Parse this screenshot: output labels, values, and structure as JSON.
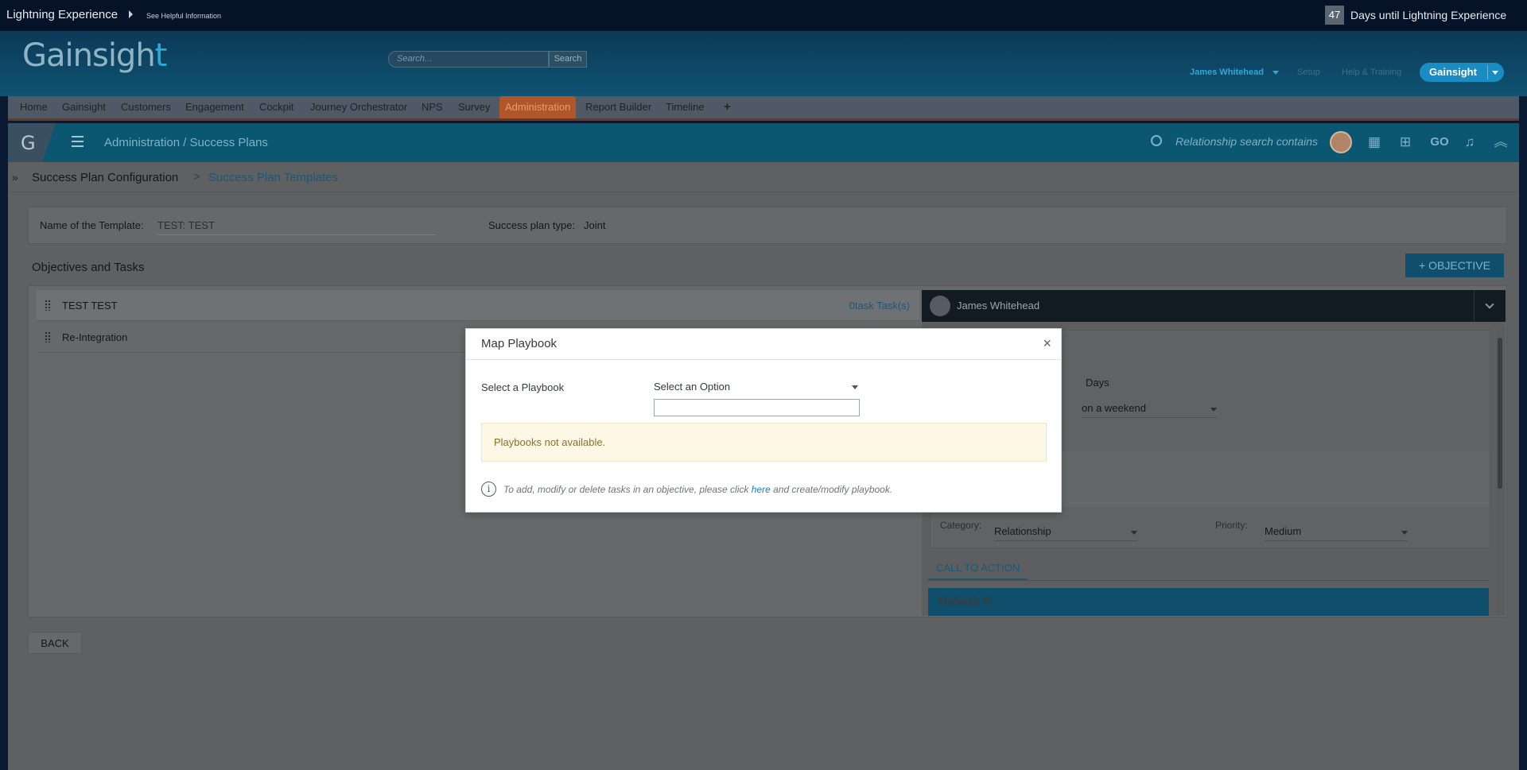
{
  "lightning": {
    "title": "Lightning Experience",
    "help": "See Helpful Information",
    "days_count": "47",
    "days_text": "Days until Lightning Experience"
  },
  "header": {
    "logo": "Gainsigh",
    "logo_t": "t",
    "search_placeholder": "Search...",
    "search_button": "Search",
    "user": "James Whitehead",
    "setup": "Setup",
    "help_training": "Help & Training",
    "app": "Gainsight"
  },
  "tabs": [
    "Home",
    "Gainsight",
    "Customers",
    "Engagement",
    "Cockpit",
    "Journey Orchestrator",
    "NPS",
    "Survey",
    "Administration",
    "Report Builder",
    "Timeline"
  ],
  "tab_plus": "+",
  "gnav": {
    "logo": "G",
    "title": "Administration / Success Plans",
    "search": "Relationship search contains",
    "icons": [
      "search-icon",
      "avatar",
      "calendar-icon",
      "hierarchy-icon",
      "go-icon",
      "bell-icon",
      "collapse-icon"
    ],
    "go_label": "GO"
  },
  "breadcrumb": {
    "toggle": "»",
    "item1": "Success Plan Configuration",
    "separator": ">",
    "item2": "Success Plan Templates"
  },
  "template": {
    "name_label": "Name of the Template:",
    "name_value": "TEST: TEST",
    "type_label": "Success plan type:",
    "type_value": "Joint"
  },
  "objectives": {
    "title": "Objectives and Tasks",
    "add_button": "+ OBJECTIVE",
    "rows": [
      {
        "name": "TEST TEST",
        "count": "0task Task(s)"
      },
      {
        "name": "Re-Integration",
        "count": ""
      }
    ]
  },
  "detail": {
    "owner": "James Whitehead",
    "days": "Days",
    "weekend": "on a weekend",
    "category_label": "Category:",
    "category_value": "Relationship",
    "priority_label": "Priority:",
    "priority_value": "Medium",
    "cta_tab": "CALL TO ACTION",
    "default_label": "Default C"
  },
  "back_button": "BACK",
  "modal": {
    "title": "Map Playbook",
    "close": "×",
    "playbook_label": "Select a Playbook",
    "select_value": "Select an Option",
    "search_value": "",
    "warning": "Playbooks not available.",
    "info_prefix": "To add, modify or delete tasks in an objective, please click ",
    "info_link": "here",
    "info_suffix": " and create/modify playbook."
  },
  "colors": {
    "modal_bg": "#ffffff",
    "warning_bg": "#fdf8e6",
    "link": "#1c7cc2",
    "active_tab": "#b0562a",
    "overlay": "#5e6062"
  }
}
